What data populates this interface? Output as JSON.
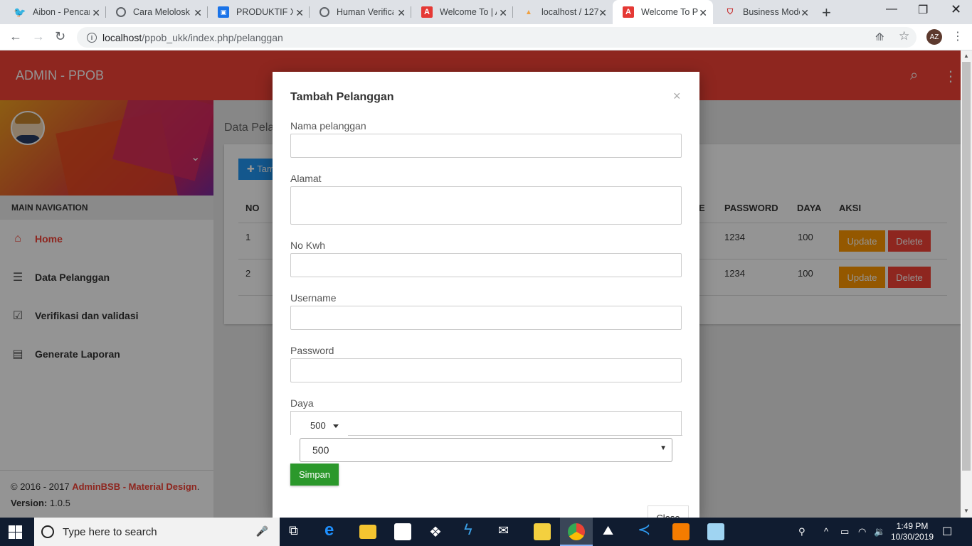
{
  "browser": {
    "tabs": [
      {
        "title": "Aibon - Pencari",
        "icon": "twitter-icon",
        "color": "#1da1f2",
        "glyph": "t"
      },
      {
        "title": "Cara Meloloskan",
        "icon": "globe-icon",
        "color": "#5f6368",
        "glyph": "◍"
      },
      {
        "title": "PRODUKTIF XII",
        "icon": "classroom-icon",
        "color": "#1a73e8",
        "glyph": "▣"
      },
      {
        "title": "Human Verification",
        "icon": "globe-icon",
        "color": "#5f6368",
        "glyph": "◍"
      },
      {
        "title": "Welcome To | A",
        "icon": "app-icon",
        "color": "#e53935",
        "glyph": "A"
      },
      {
        "title": "localhost / 127",
        "icon": "phpmyadmin-icon",
        "color": "#f0a040",
        "glyph": "⛵"
      },
      {
        "title": "Welcome To PI",
        "icon": "app-icon",
        "color": "#e53935",
        "glyph": "A"
      },
      {
        "title": "Business Model",
        "icon": "shield-icon",
        "color": "#c62828",
        "glyph": "⛉"
      }
    ],
    "new_tab": "+",
    "url_host": "localhost",
    "url_path": "/ppob_ukk/index.php/pelanggan",
    "profile": "AZ"
  },
  "app": {
    "brand": "ADMIN - PPOB",
    "menu_header": "MAIN NAVIGATION",
    "menu": [
      {
        "label": "Home",
        "icon": "home-icon",
        "glyph": "⌂"
      },
      {
        "label": "Data Pelanggan",
        "icon": "list-icon",
        "glyph": "☰"
      },
      {
        "label": "Verifikasi dan validasi",
        "icon": "check-box-icon",
        "glyph": "☑"
      },
      {
        "label": "Generate Laporan",
        "icon": "clipboard-icon",
        "glyph": "▤"
      }
    ],
    "footer_copy": "© 2016 - 2017 ",
    "footer_link": "AdminBSB - Material Design",
    "footer_dot": ".",
    "version_label": "Version:",
    "version": "1.0.5",
    "page_title": "Data Pelanggan",
    "add_button": "Tambah",
    "table": {
      "headers": {
        "no": "NO",
        "e": "E",
        "password": "PASSWORD",
        "daya": "DAYA",
        "aksi": "AKSI"
      },
      "rows": [
        {
          "no": "1",
          "password": "1234",
          "daya": "100"
        },
        {
          "no": "2",
          "password": "1234",
          "daya": "100"
        }
      ],
      "update": "Update",
      "delete": "Delete"
    }
  },
  "modal": {
    "title": "Tambah Pelanggan",
    "close_x": "×",
    "fields": {
      "nama": "Nama pelanggan",
      "alamat": "Alamat",
      "nokwh": "No Kwh",
      "username": "Username",
      "password": "Password",
      "daya": "Daya"
    },
    "daya_dropdown": "500",
    "daya_select": "500",
    "submit": "Simpan",
    "close": "Close"
  },
  "taskbar": {
    "search_placeholder": "Type here to search",
    "time": "1:49 PM",
    "date": "10/30/2019"
  },
  "colors": {
    "accent": "#f44336",
    "primary": "#2196f3",
    "success": "#2b982b",
    "warning": "#ff9800"
  }
}
